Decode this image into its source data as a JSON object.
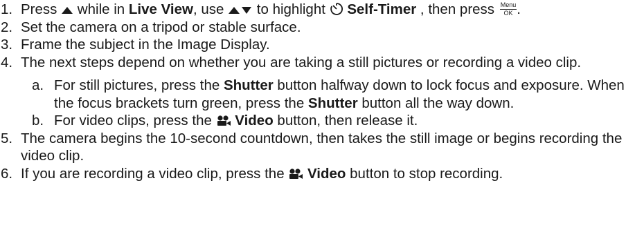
{
  "steps": [
    {
      "num": "1.",
      "t1": "Press ",
      "t2": " while in ",
      "b1": "Live View",
      "t3": ", use ",
      "t4": " to highlight ",
      "b2": "Self-Timer",
      "t5": " , then press ",
      "t6": "."
    },
    {
      "num": "2.",
      "text": "Set the camera on a tripod or stable surface."
    },
    {
      "num": "3.",
      "text": "Frame the subject in the Image Display."
    },
    {
      "num": "4.",
      "text": "The next steps depend on whether you are taking a still pictures or recording a video clip."
    },
    {
      "num": "5.",
      "text": "The camera begins the 10-second countdown, then takes the still image or begins recording the video clip."
    },
    {
      "num": "6.",
      "t1": "If you are recording a video clip, press the ",
      "b1": "Video",
      "t2": " button to stop recording."
    }
  ],
  "substeps": [
    {
      "letter": "a.",
      "t1": "For still pictures, press the ",
      "b1": "Shutter",
      "t2": " button halfway down to lock focus and exposure. When the focus brackets turn green, press the ",
      "b2": "Shutter",
      "t3": " button all the way down."
    },
    {
      "letter": "b.",
      "t1": "For video clips, press the ",
      "b1": "Video",
      "t2": " button, then release it."
    }
  ],
  "menu_ok": {
    "top": "Menu",
    "bottom": "OK"
  },
  "icons": {
    "up_arrow": "up-arrow-icon",
    "up_down_arrows": "up-down-arrows-icon",
    "self_timer": "self-timer-icon",
    "video": "video-camera-icon"
  },
  "colors": {
    "text": "#1a1a1a",
    "background": "#ffffff"
  }
}
